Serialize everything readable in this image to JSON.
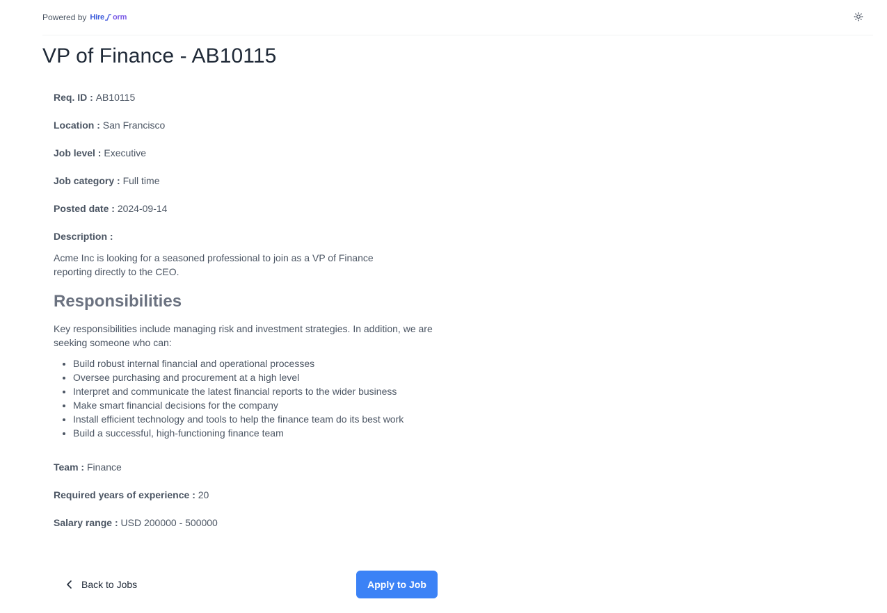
{
  "header": {
    "powered_by": "Powered by",
    "logo_part1": "Hire",
    "logo_part2": "orm",
    "theme_icon": "sun-icon"
  },
  "job": {
    "title": "VP of Finance - AB10115",
    "fields_top": [
      {
        "label": "Req. ID",
        "value": "AB10115"
      },
      {
        "label": "Location",
        "value": "San Francisco"
      },
      {
        "label": "Job level",
        "value": "Executive"
      },
      {
        "label": "Job category",
        "value": "Full time"
      },
      {
        "label": "Posted date",
        "value": "2024-09-14"
      }
    ],
    "description_label": "Description",
    "description": "Acme Inc is looking for a seasoned professional to join as a VP of Finance reporting directly to the CEO.",
    "responsibilities_heading": "Responsibilities",
    "responsibilities_intro": "Key responsibilities include managing risk and investment strategies. In addition, we are seeking someone who can:",
    "responsibilities": [
      "Build robust internal financial and operational processes",
      "Oversee purchasing and procurement at a high level",
      "Interpret and communicate the latest financial reports to the wider business",
      "Make smart financial decisions for the company",
      "Install efficient technology and tools to help the finance team do its best work",
      "Build a successful, high-functioning finance team"
    ],
    "fields_bottom": [
      {
        "label": "Team",
        "value": "Finance"
      },
      {
        "label": "Required years of experience",
        "value": "20"
      },
      {
        "label": "Salary range",
        "value": "USD 200000 - 500000"
      }
    ]
  },
  "footer": {
    "back_label": "Back to Jobs",
    "apply_label": "Apply to Job"
  },
  "colors": {
    "primary": "#3b82f6",
    "text": "#4b5563",
    "title": "#1f2937"
  }
}
